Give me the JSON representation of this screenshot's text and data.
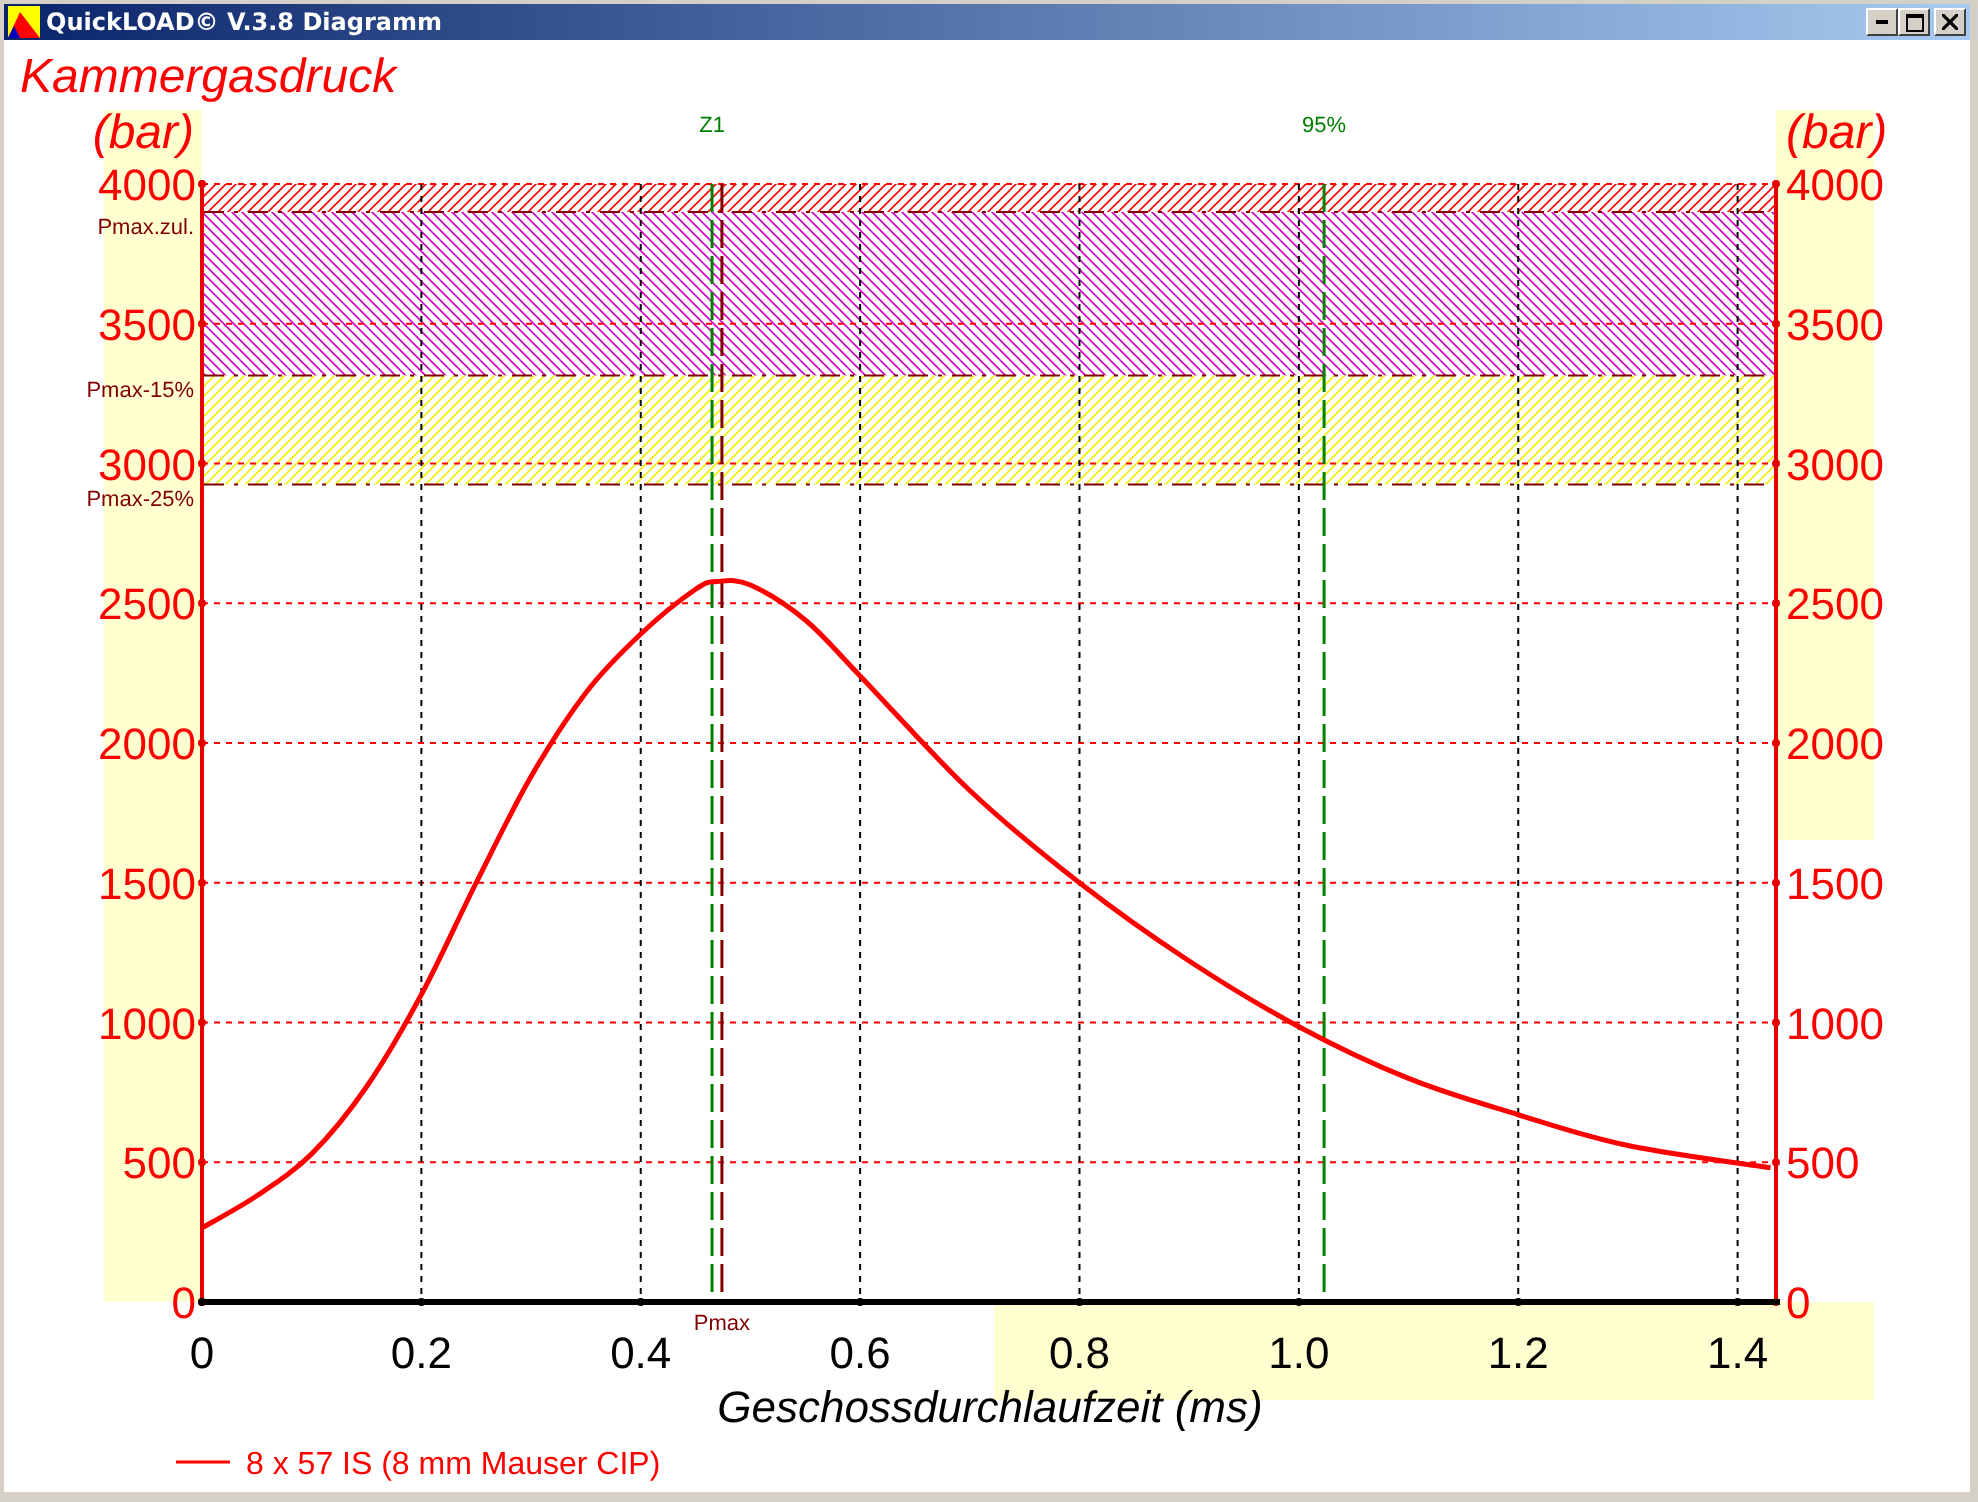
{
  "window": {
    "title": "QuickLOAD© V.3.8 Diagramm"
  },
  "chart": {
    "marker_labels": [
      "Z1",
      "Pmax",
      "95%"
    ],
    "chart_data": {
      "type": "line",
      "title": "Kammergasdruck",
      "ylabel": "(bar)",
      "y2label": "(bar)",
      "xlabel": "Geschossdurchlaufzeit (ms)",
      "x": [
        0,
        0.05,
        0.1,
        0.15,
        0.2,
        0.25,
        0.3,
        0.35,
        0.4,
        0.45,
        0.47,
        0.5,
        0.55,
        0.6,
        0.7,
        0.8,
        0.9,
        1.0,
        1.1,
        1.2,
        1.3,
        1.43
      ],
      "series": [
        {
          "name": "8 x 57 IS (8 mm Mauser CIP)",
          "color": "#ff0000",
          "values": [
            265,
            380,
            530,
            770,
            1100,
            1500,
            1880,
            2180,
            2390,
            2550,
            2578,
            2565,
            2440,
            2240,
            1830,
            1500,
            1220,
            985,
            800,
            670,
            560,
            480
          ]
        }
      ],
      "xlim": [
        0,
        1.435
      ],
      "ylim": [
        0,
        4000
      ],
      "xticks": [
        {
          "value": 0,
          "label": "0"
        },
        {
          "value": 0.2,
          "label": "0.2"
        },
        {
          "value": 0.4,
          "label": "0.4"
        },
        {
          "value": 0.6,
          "label": "0.6"
        },
        {
          "value": 0.8,
          "label": "0.8"
        },
        {
          "value": 1.0,
          "label": "1.0"
        },
        {
          "value": 1.2,
          "label": "1.2"
        },
        {
          "value": 1.4,
          "label": "1.4"
        }
      ],
      "yticks": [
        0,
        500,
        1000,
        1500,
        2000,
        2500,
        3000,
        3500,
        4000
      ],
      "y2lim": [
        0,
        4000
      ],
      "y2ticks": [
        0,
        500,
        1000,
        1500,
        2000,
        2500,
        3000,
        3500,
        4000
      ],
      "grid": true,
      "bands": [
        {
          "axis": "y",
          "from": 3900,
          "to": 4000,
          "color": "#ff0000"
        },
        {
          "axis": "y",
          "from": 3315,
          "to": 3900,
          "color": "#cc00cc"
        },
        {
          "axis": "y",
          "from": 2925,
          "to": 3315,
          "color": "#f0f000"
        }
      ],
      "ref_lines": [
        {
          "axis": "y",
          "value": 3900,
          "label": "Pmax.zul."
        },
        {
          "axis": "y",
          "value": 3315,
          "label": "Pmax-15%"
        },
        {
          "axis": "y",
          "value": 2925,
          "label": "Pmax-25%"
        },
        {
          "axis": "x",
          "value": 0.465,
          "color": "#008000"
        },
        {
          "axis": "x",
          "value": 0.474,
          "color": "#800000"
        },
        {
          "axis": "x",
          "value": 1.023,
          "color": "#008000"
        }
      ]
    }
  }
}
